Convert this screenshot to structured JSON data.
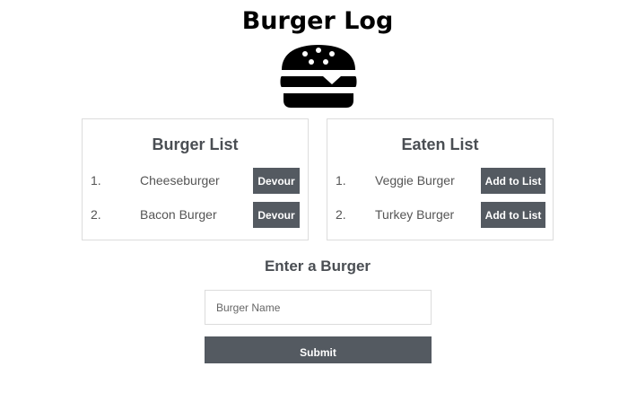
{
  "header": {
    "title": "Burger Log",
    "logo_icon": "hamburger-icon"
  },
  "burger_list": {
    "title": "Burger List",
    "items": [
      {
        "number": "1.",
        "name": "Cheeseburger",
        "action": "Devour"
      },
      {
        "number": "2.",
        "name": "Bacon Burger",
        "action": "Devour"
      }
    ]
  },
  "eaten_list": {
    "title": "Eaten List",
    "items": [
      {
        "number": "1.",
        "name": "Veggie Burger",
        "action": "Add to List"
      },
      {
        "number": "2.",
        "name": "Turkey Burger",
        "action": "Add to List"
      }
    ]
  },
  "form": {
    "title": "Enter a Burger",
    "input_value": "",
    "input_placeholder": "Burger Name",
    "submit_label": "Submit"
  },
  "colors": {
    "button_bg": "#545a61",
    "heading_text": "#4a4e53"
  }
}
